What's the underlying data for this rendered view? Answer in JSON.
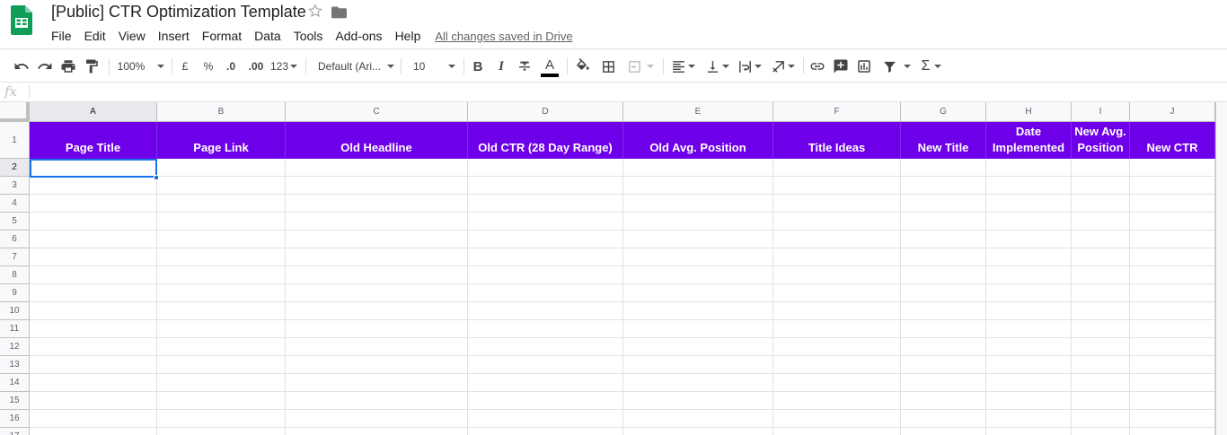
{
  "app": {
    "title": "[Public] CTR Optimization Template",
    "logo_icon": "google-sheets-logo",
    "accent_green": "#0f9d58"
  },
  "menu": {
    "items": [
      "File",
      "Edit",
      "View",
      "Insert",
      "Format",
      "Data",
      "Tools",
      "Add-ons",
      "Help"
    ],
    "save_status": "All changes saved in Drive"
  },
  "toolbar": {
    "zoom": "100%",
    "currency": "£",
    "percent": "%",
    "decrease_decimal": ".0",
    "increase_decimal": ".00",
    "more_formats": "123",
    "font_family": "Default (Ari...",
    "font_size": "10",
    "bold": "B",
    "italic": "I",
    "text_color_label": "A",
    "function_label": "Σ"
  },
  "formula_bar": {
    "fx_label": "fx",
    "value": ""
  },
  "sheet": {
    "columns": [
      "A",
      "B",
      "C",
      "D",
      "E",
      "F",
      "G",
      "H",
      "I",
      "J"
    ],
    "rows": [
      "1",
      "2",
      "3",
      "4",
      "5",
      "6",
      "7",
      "8",
      "9",
      "10",
      "11",
      "12",
      "13",
      "14",
      "15",
      "16",
      "17"
    ],
    "header_row_color": "#6d00e8",
    "header_row": [
      [
        "Page Title"
      ],
      [
        "Page Link"
      ],
      [
        "Old Headline"
      ],
      [
        "Old CTR (28 Day Range)"
      ],
      [
        "Old Avg. Position"
      ],
      [
        "Title Ideas"
      ],
      [
        "New Title"
      ],
      [
        "Date",
        "Implemented"
      ],
      [
        "New Avg.",
        "Position"
      ],
      [
        "New CTR"
      ]
    ],
    "selected_cell": "A2"
  }
}
